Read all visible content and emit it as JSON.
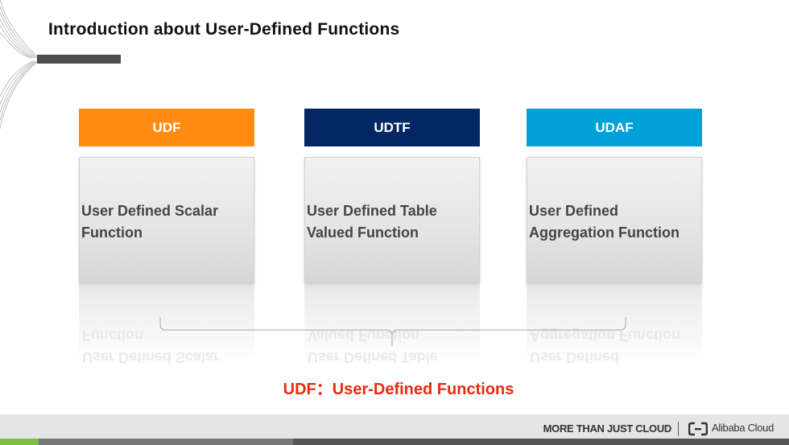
{
  "title": "Introduction about User-Defined Functions",
  "colors": {
    "udf": "#ff8b12",
    "udtf": "#022763",
    "udaf": "#00a1d8",
    "subtitle": "#ea2a0e",
    "progress": "#7bc142"
  },
  "boxes": [
    {
      "label": "UDF",
      "description": "User Defined Scalar Function",
      "line1": "User Defined Scalar",
      "line2": "Function"
    },
    {
      "label": "UDTF",
      "description": "User Defined Table Valued Function",
      "line1": "User Defined Table",
      "line2": "Valued Function"
    },
    {
      "label": "UDAF",
      "description": "User Defined Aggregation Function",
      "line1": "User Defined",
      "line2": "Aggregation Function"
    }
  ],
  "subtitle": "UDF：User-Defined Functions",
  "footer": {
    "tagline": "MORE THAN JUST CLOUD",
    "brand": "Alibaba Cloud",
    "logo_icon": "alibaba-cloud-logo-icon"
  },
  "progress": {
    "fraction": 0.049
  }
}
